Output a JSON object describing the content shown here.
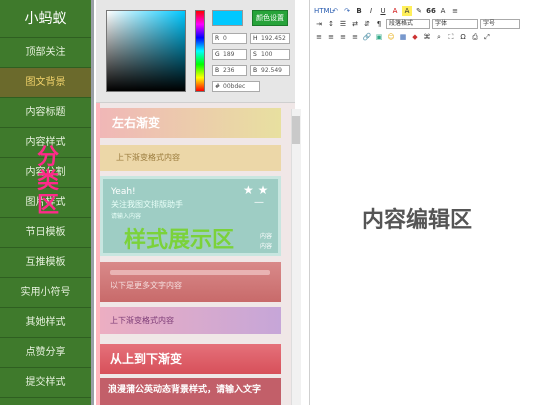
{
  "sidebar": {
    "brand": "小蚂蚁",
    "items": [
      {
        "label": "顶部关注"
      },
      {
        "label": "图文背景"
      },
      {
        "label": "内容标题"
      },
      {
        "label": "内容样式"
      },
      {
        "label": "内容分割"
      },
      {
        "label": "图片样式"
      },
      {
        "label": "节日模板"
      },
      {
        "label": "互推模板"
      },
      {
        "label": "实用小符号"
      },
      {
        "label": "其她样式"
      },
      {
        "label": "点赞分享"
      },
      {
        "label": "提交样式"
      }
    ],
    "active_index": 1,
    "overlay_text": "分类区"
  },
  "picker": {
    "button_label": "颜色设置",
    "swatch_color": "#00c8ff",
    "fields": {
      "r": {
        "label": "R",
        "value": "0"
      },
      "g": {
        "label": "G",
        "value": "189"
      },
      "b": {
        "label": "B",
        "value": "236"
      },
      "h": {
        "label": "H",
        "value": "192.452"
      },
      "s": {
        "label": "S",
        "value": "100"
      },
      "bright": {
        "label": "B",
        "value": "92.549"
      },
      "hex": {
        "label": "#",
        "value": "00bdec"
      }
    }
  },
  "styles": {
    "overlay_text": "样式展示区",
    "card1_title": "左右渐变",
    "card2_text": "上下渐变格式内容",
    "card3": {
      "line1": "Yeah!",
      "line2": "关注我图文排版助手",
      "line3": "请输入内容",
      "stars": "★ ★",
      "dash": "—",
      "right1": "内容",
      "right2": "内容"
    },
    "card4_text": "以下是更多文字内容",
    "card5_text": "上下渐变格式内容",
    "card6_title": "从上到下渐变",
    "card7_text": "浪漫蒲公英动态背景样式，请输入文字"
  },
  "editor": {
    "label": "内容编辑区",
    "toolbar": {
      "row1": [
        "html-icon",
        "undo-icon",
        "redo-icon",
        "bold-icon",
        "italic-icon",
        "underline-icon",
        "font-color-icon",
        "highlight-icon",
        "erase-icon",
        "quote-icon",
        "text-size-icon",
        "list-icon"
      ],
      "row1_labels": [
        "HTML",
        "↶",
        "↷",
        "B",
        "I",
        "U",
        "A",
        "A",
        "✎",
        "66",
        "A",
        "≡"
      ],
      "row2_selects": {
        "paragraph": "段落格式",
        "font": "字体",
        "size": "字号"
      },
      "row3": [
        "align-left-icon",
        "align-center-icon",
        "align-right-icon",
        "justify-icon",
        "link-icon",
        "image-icon",
        "emoji-icon",
        "table-icon",
        "map-icon",
        "code-icon",
        "search-icon",
        "preview-icon"
      ]
    }
  }
}
